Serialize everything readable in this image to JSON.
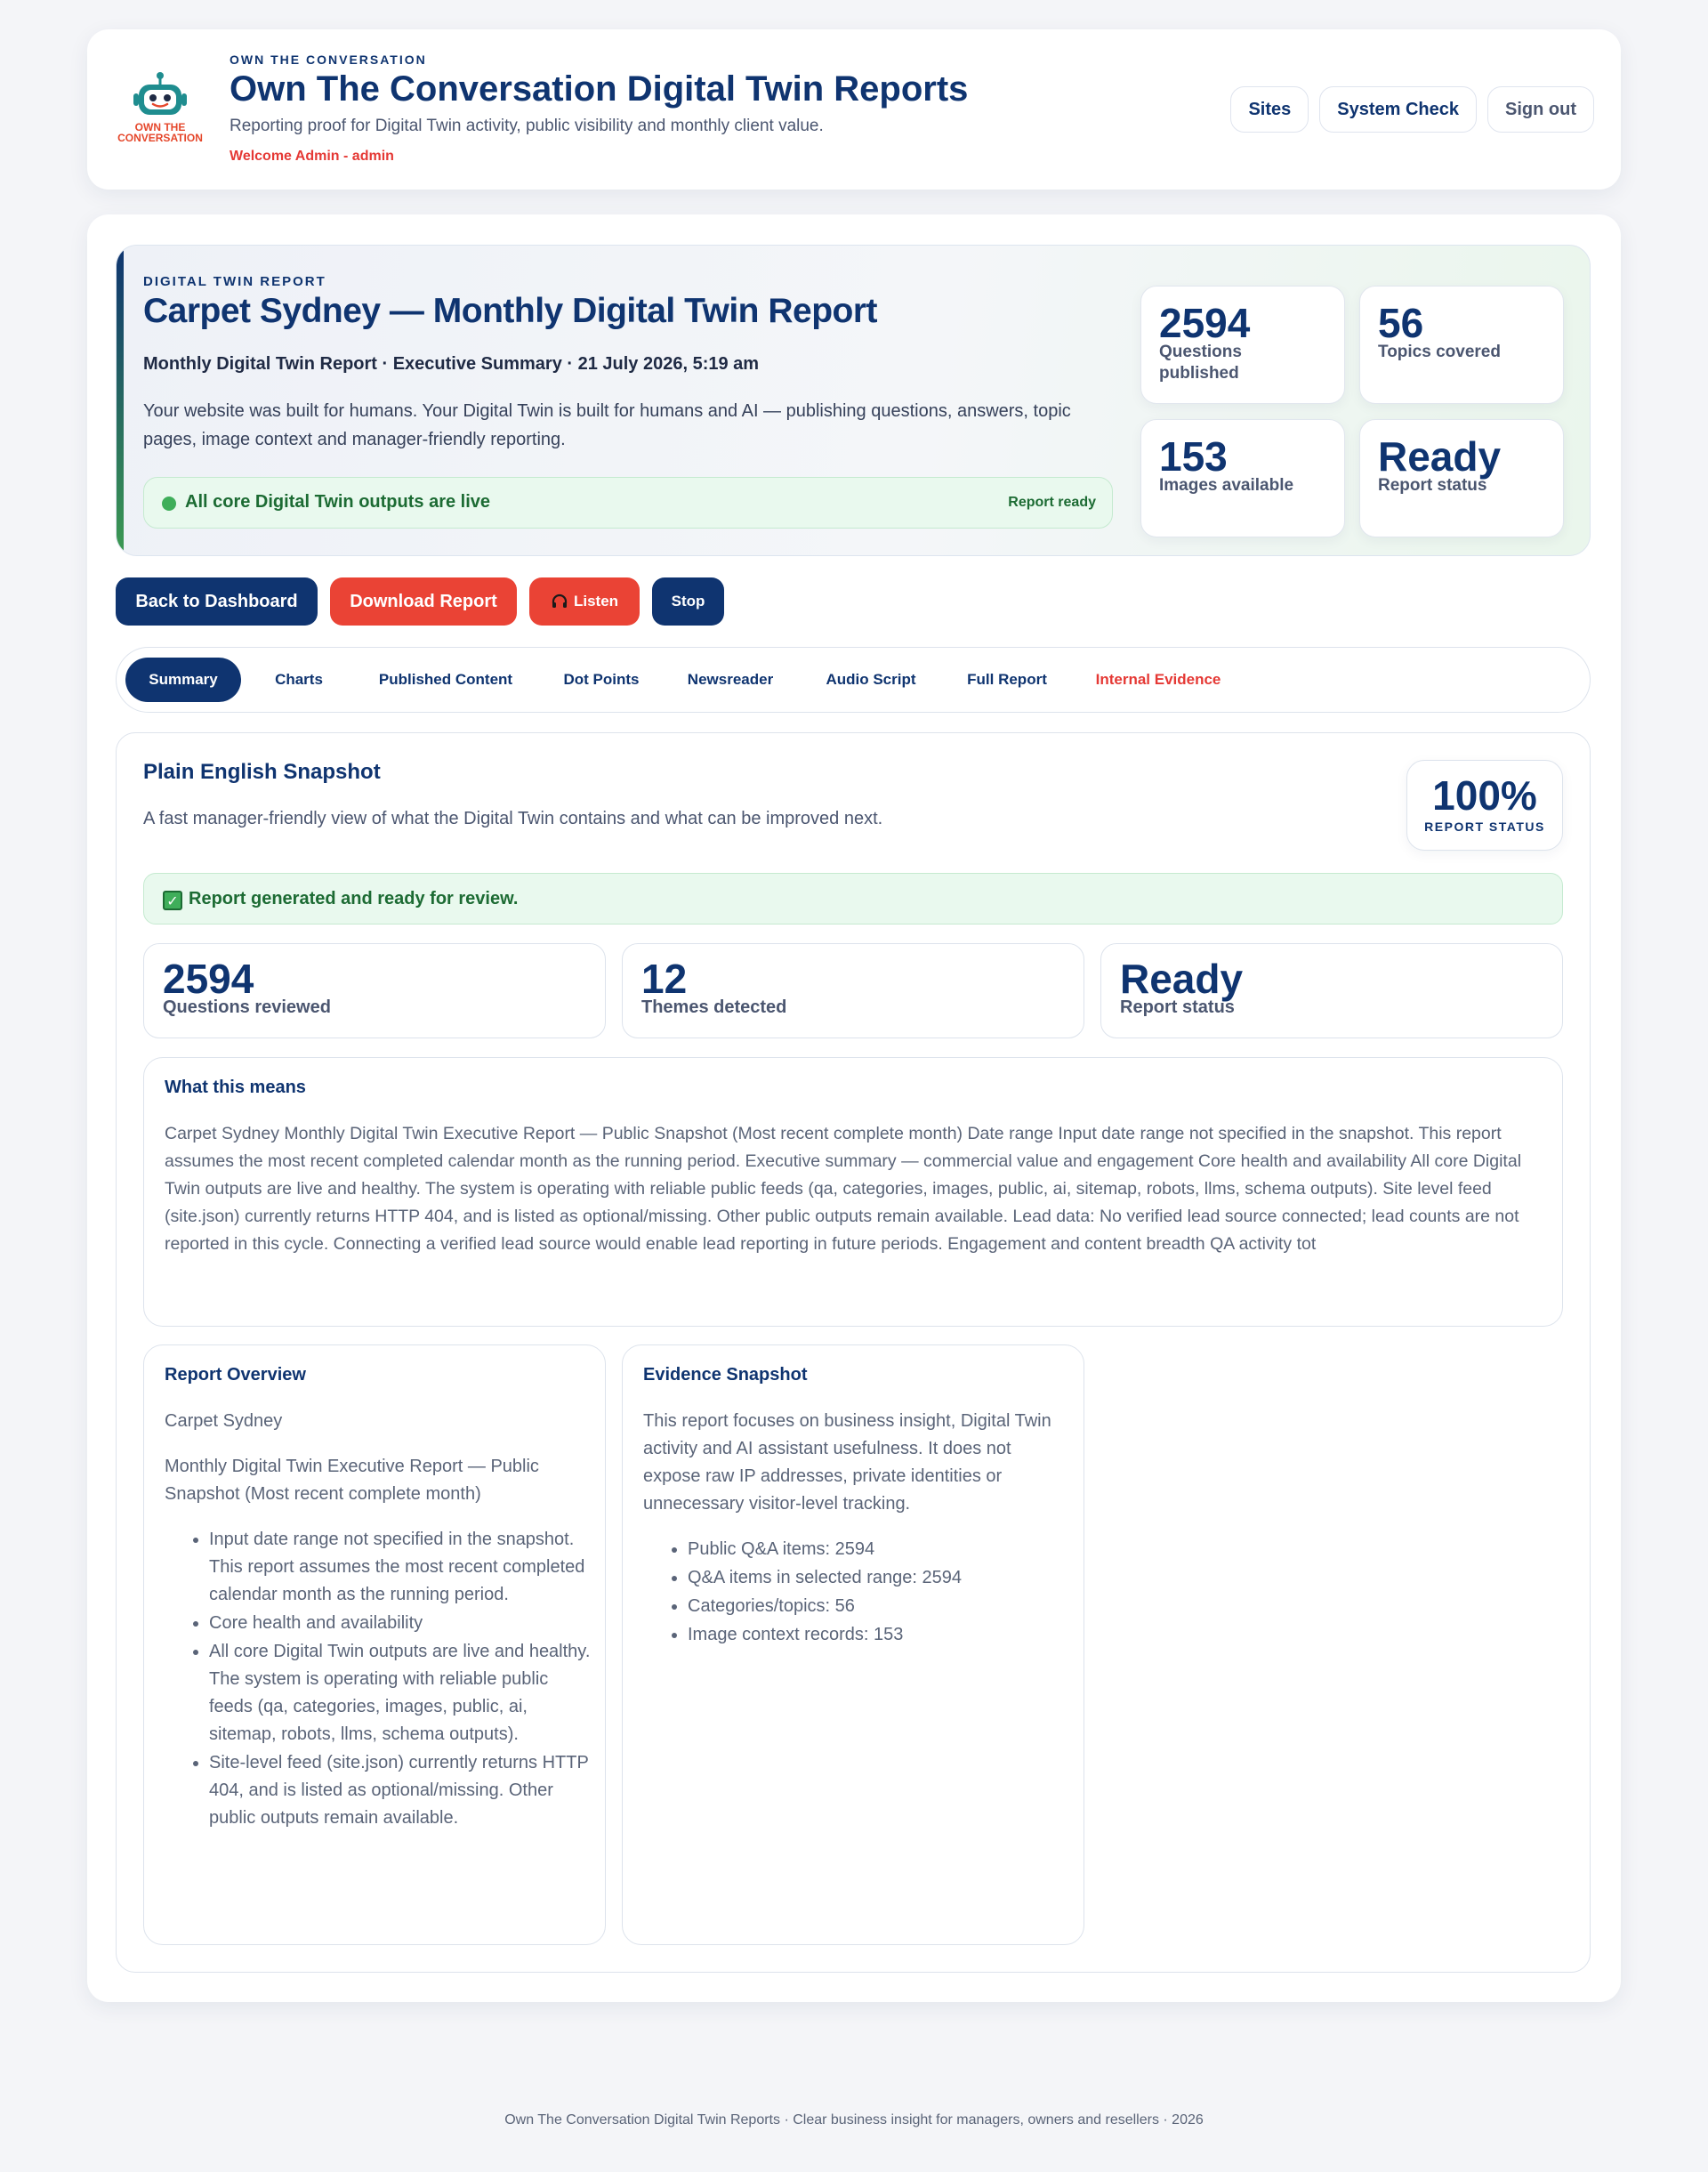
{
  "brand": {
    "logo_text_line1": "OWN THE",
    "logo_text_line2": "CONVERSATION",
    "kicker": "OWN THE CONVERSATION",
    "title": "Own The Conversation Digital Twin Reports",
    "subtitle": "Reporting proof for Digital Twin activity, public visibility and monthly client value.",
    "welcome": "Welcome Admin - admin"
  },
  "nav": {
    "sites": "Sites",
    "system_check": "System Check",
    "sign_out": "Sign out"
  },
  "hero": {
    "kicker": "DIGITAL TWIN REPORT",
    "title": "Carpet Sydney — Monthly Digital Twin Report",
    "meta": "Monthly Digital Twin Report · Executive Summary · 21 July 2026, 5:19 am",
    "description": "Your website was built for humans. Your Digital Twin is built for humans and AI — publishing questions, answers, topic pages, image context and manager-friendly reporting.",
    "live_text": "All core Digital Twin outputs are live",
    "live_badge": "Report ready",
    "stats": [
      {
        "value": "2594",
        "label": "Questions published"
      },
      {
        "value": "56",
        "label": "Topics covered"
      },
      {
        "value": "153",
        "label": "Images available"
      },
      {
        "value": "Ready",
        "label": "Report status"
      }
    ]
  },
  "actions": {
    "back": "Back to Dashboard",
    "download": "Download Report",
    "listen": "Listen",
    "listen_icon": "headphones-icon",
    "stop": "Stop"
  },
  "tabs": [
    "Summary",
    "Charts",
    "Published Content",
    "Dot Points",
    "Newsreader",
    "Audio Script",
    "Full Report",
    "Internal Evidence"
  ],
  "active_tab": "Summary",
  "snapshot": {
    "title": "Plain English Snapshot",
    "subtitle": "A fast manager-friendly view of what the Digital Twin contains and what can be improved next.",
    "status_value": "100%",
    "status_label": "REPORT STATUS",
    "ready_icon": "check-icon",
    "ready_text": "Report generated and ready for review.",
    "metrics": [
      {
        "value": "2594",
        "label": "Questions reviewed"
      },
      {
        "value": "12",
        "label": "Themes detected"
      },
      {
        "value": "Ready",
        "label": "Report status"
      }
    ],
    "what_title": "What this means",
    "what_body": "Carpet Sydney Monthly Digital Twin Executive Report — Public Snapshot (Most recent complete month) Date range Input date range not specified in the snapshot. This report assumes the most recent completed calendar month as the running period. Executive summary — commercial value and engagement Core health and availability All core Digital Twin outputs are live and healthy. The system is operating with reliable public feeds (qa, categories, images, public, ai, sitemap, robots, llms, schema outputs). Site level feed (site.json) currently returns HTTP 404, and is listed as optional/missing. Other public outputs remain available. Lead data: No verified lead source connected; lead counts are not reported in this cycle. Connecting a verified lead source would enable lead reporting in future periods. Engagement and content breadth QA activity tot"
  },
  "overview": {
    "title": "Report Overview",
    "client": "Carpet Sydney",
    "report_name": "Monthly Digital Twin Executive Report — Public Snapshot (Most recent complete month)",
    "bullets": [
      "Input date range not specified in the snapshot. This report assumes the most recent completed calendar month as the running period.",
      "Core health and availability",
      "All core Digital Twin outputs are live and healthy. The system is operating with reliable public feeds (qa, categories, images, public, ai, sitemap, robots, llms, schema outputs).",
      "Site-level feed (site.json) currently returns HTTP 404, and is listed as optional/missing. Other public outputs remain available."
    ]
  },
  "evidence": {
    "title": "Evidence Snapshot",
    "body": "This report focuses on business insight, Digital Twin activity and AI assistant usefulness. It does not expose raw IP addresses, private identities or unnecessary visitor-level tracking.",
    "bullets": [
      "Public Q&A items: 2594",
      "Q&A items in selected range: 2594",
      "Categories/topics: 56",
      "Image context records: 153"
    ]
  },
  "footer": "Own The Conversation Digital Twin Reports · Clear business insight for managers, owners and resellers · 2026",
  "colors": {
    "navy": "#0f3470",
    "red": "#ea4335",
    "green": "#3fae5a",
    "green_bg": "#e9f9ee"
  }
}
